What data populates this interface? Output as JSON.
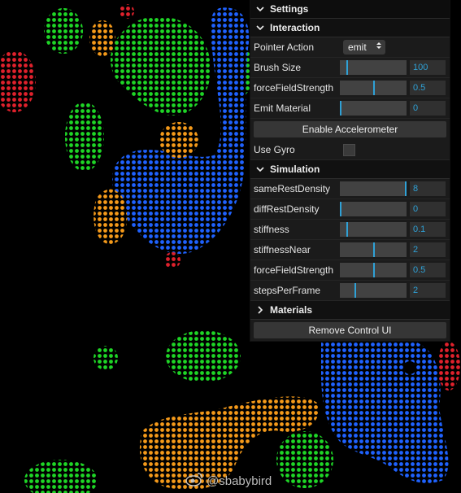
{
  "settings": {
    "title": "Settings"
  },
  "interaction": {
    "title": "Interaction",
    "pointer_action": {
      "label": "Pointer Action",
      "value": "emit"
    },
    "brush_size": {
      "label": "Brush Size",
      "value": "100",
      "level": 0.1
    },
    "force_field_strength": {
      "label": "forceFieldStrength",
      "value": "0.5",
      "level": 0.5
    },
    "emit_material": {
      "label": "Emit Material",
      "value": "0",
      "level": 0.0
    },
    "accelerometer_button": "Enable Accelerometer",
    "use_gyro": {
      "label": "Use Gyro",
      "checked": false
    }
  },
  "simulation": {
    "title": "Simulation",
    "params": [
      {
        "label": "sameRestDensity",
        "value": "8",
        "level": 0.97
      },
      {
        "label": "diffRestDensity",
        "value": "0",
        "level": 0.0
      },
      {
        "label": "stiffness",
        "value": "0.1",
        "level": 0.1
      },
      {
        "label": "stiffnessNear",
        "value": "2",
        "level": 0.5
      },
      {
        "label": "forceFieldStrength",
        "value": "0.5",
        "level": 0.5
      },
      {
        "label": "stepsPerFrame",
        "value": "2",
        "level": 0.22
      }
    ]
  },
  "materials": {
    "title": "Materials"
  },
  "remove_button": "Remove Control UI",
  "watermark": {
    "text": "@sbabybird"
  },
  "colors": {
    "accent": "#2fa1d6",
    "blue_particles": "#1f62ff",
    "green_particles": "#1ed626",
    "orange_particles": "#f59a1a",
    "red_particles": "#e0212c"
  }
}
